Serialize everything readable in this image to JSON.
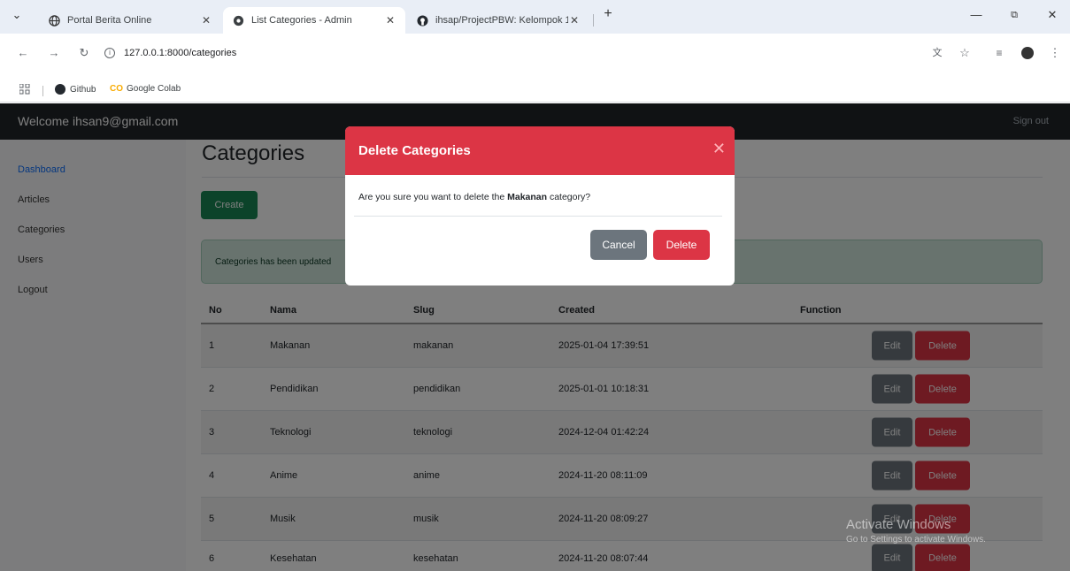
{
  "browser": {
    "tabs": [
      {
        "title": "Portal Berita Online"
      },
      {
        "title": "List Categories - Admin"
      },
      {
        "title": "ihsap/ProjectPBW: Kelompok 1("
      }
    ],
    "url": "127.0.0.1:8000/categories",
    "bookmarks": [
      {
        "label": "Github"
      },
      {
        "label": "Google Colab"
      }
    ]
  },
  "navbar": {
    "welcome": "Welcome ihsan9@gmail.com",
    "signout": "Sign out"
  },
  "sidebar": {
    "items": [
      {
        "label": "Dashboard"
      },
      {
        "label": "Articles"
      },
      {
        "label": "Categories"
      },
      {
        "label": "Users"
      },
      {
        "label": "Logout"
      }
    ]
  },
  "main": {
    "title": "Categories",
    "create_label": "Create",
    "alert": "Categories has been updated"
  },
  "table": {
    "headers": [
      "No",
      "Nama",
      "Slug",
      "Created",
      "Function"
    ],
    "rows": [
      {
        "no": "1",
        "nama": "Makanan",
        "slug": "makanan",
        "created": "2025-01-04 17:39:51"
      },
      {
        "no": "2",
        "nama": "Pendidikan",
        "slug": "pendidikan",
        "created": "2025-01-01 10:18:31"
      },
      {
        "no": "3",
        "nama": "Teknologi",
        "slug": "teknologi",
        "created": "2024-12-04 01:42:24"
      },
      {
        "no": "4",
        "nama": "Anime",
        "slug": "anime",
        "created": "2024-11-20 08:11:09"
      },
      {
        "no": "5",
        "nama": "Musik",
        "slug": "musik",
        "created": "2024-11-20 08:09:27"
      },
      {
        "no": "6",
        "nama": "Kesehatan",
        "slug": "kesehatan",
        "created": "2024-11-20 08:07:44"
      }
    ],
    "edit_label": "Edit",
    "delete_label": "Delete"
  },
  "modal": {
    "title": "Delete Categories",
    "body_prefix": "Are you sure you want to delete the ",
    "body_name": "Makanan",
    "body_suffix": " category?",
    "cancel_label": "Cancel",
    "delete_label": "Delete"
  },
  "watermark": {
    "line1": "Activate Windows",
    "line2": "Go to Settings to activate Windows."
  },
  "colors": {
    "danger": "#dc3545",
    "success": "#198754",
    "secondary": "#6c757d",
    "navbar": "#212529",
    "primary": "#0d6efd"
  }
}
